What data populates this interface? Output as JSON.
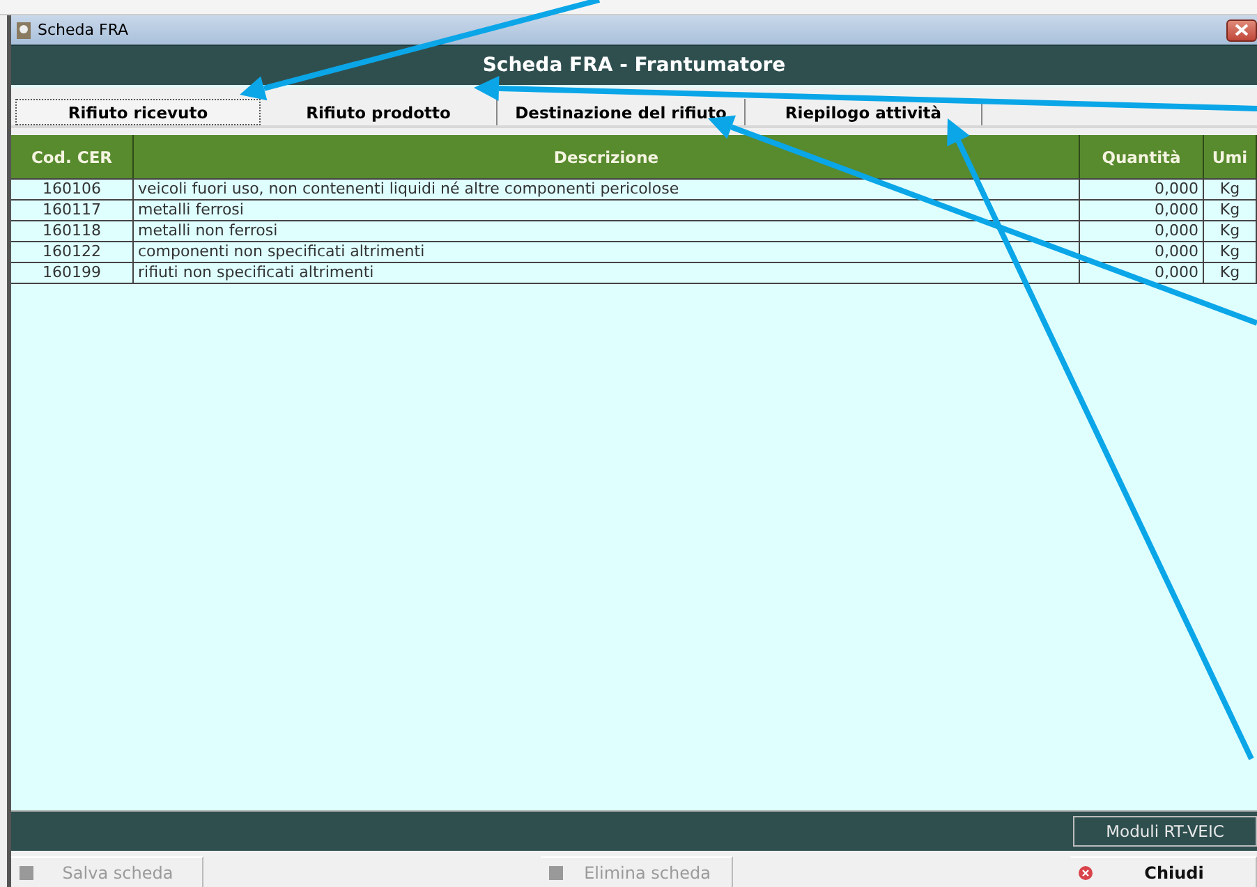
{
  "window": {
    "title": "Scheda FRA"
  },
  "header": "Scheda FRA - Frantumatore",
  "tabs": [
    {
      "label": "Rifiuto ricevuto",
      "selected": true
    },
    {
      "label": "Rifiuto prodotto",
      "selected": false
    },
    {
      "label": "Destinazione del rifiuto",
      "selected": false
    },
    {
      "label": "Riepilogo attività",
      "selected": false
    }
  ],
  "table": {
    "columns": [
      "Cod. CER",
      "Descrizione",
      "Quantità",
      "Umi"
    ],
    "rows": [
      {
        "cells": [
          "160106",
          "veicoli fuori uso, non contenenti liquidi né altre componenti pericolose",
          "0,000",
          "Kg"
        ]
      },
      {
        "cells": [
          "160117",
          "metalli ferrosi",
          "0,000",
          "Kg"
        ]
      },
      {
        "cells": [
          "160118",
          "metalli non ferrosi",
          "0,000",
          "Kg"
        ]
      },
      {
        "cells": [
          "160122",
          "componenti non specificati altrimenti",
          "0,000",
          "Kg"
        ]
      },
      {
        "cells": [
          "160199",
          "rifiuti non specificati altrimenti",
          "0,000",
          "Kg"
        ]
      }
    ]
  },
  "modules_button": "Moduli RT-VEIC",
  "buttons": [
    {
      "kind": "save",
      "label": "Salva scheda",
      "disabled": true
    },
    {
      "kind": "delete",
      "label": "Elimina scheda",
      "disabled": true
    },
    {
      "kind": "close",
      "label": "Chiudi",
      "disabled": false
    }
  ]
}
